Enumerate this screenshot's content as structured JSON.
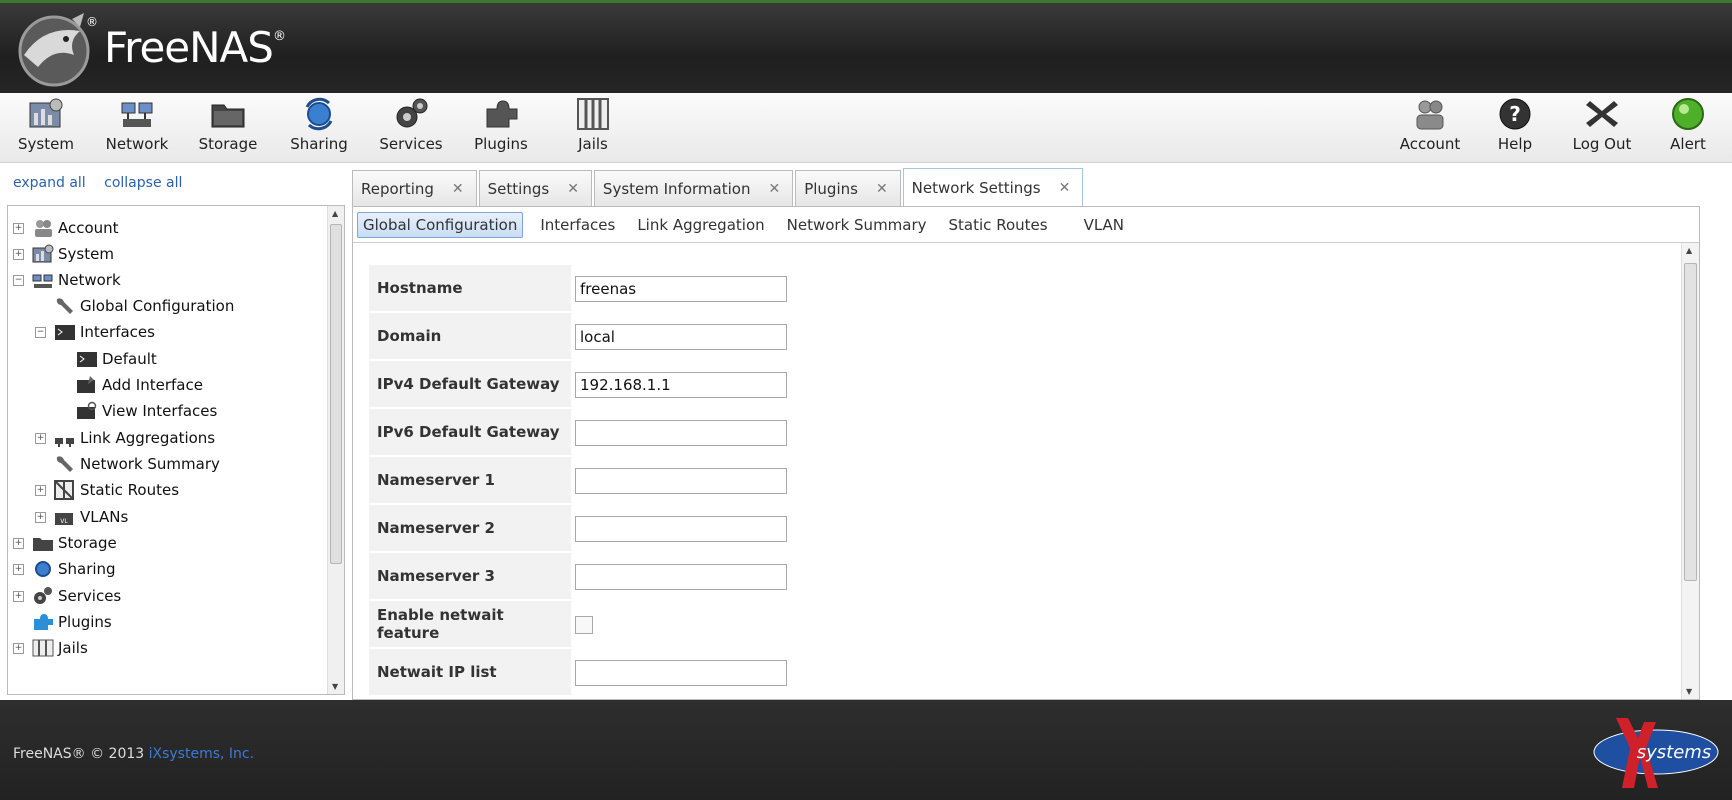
{
  "brand": {
    "name": "FreeNAS",
    "reg": "®",
    "reg_small": "®"
  },
  "toolbar": {
    "left": [
      {
        "label": "System",
        "icon": "system-icon"
      },
      {
        "label": "Network",
        "icon": "network-icon"
      },
      {
        "label": "Storage",
        "icon": "storage-icon"
      },
      {
        "label": "Sharing",
        "icon": "sharing-icon"
      },
      {
        "label": "Services",
        "icon": "services-icon"
      },
      {
        "label": "Plugins",
        "icon": "plugins-icon"
      },
      {
        "label": "Jails",
        "icon": "jails-icon"
      }
    ],
    "right": [
      {
        "label": "Account",
        "icon": "account-icon"
      },
      {
        "label": "Help",
        "icon": "help-icon"
      },
      {
        "label": "Log Out",
        "icon": "logout-icon"
      },
      {
        "label": "Alert",
        "icon": "alert-icon"
      }
    ]
  },
  "sidebar": {
    "expand_all": "expand all",
    "collapse_all": "collapse all",
    "items": [
      {
        "label": "Account",
        "toggle": "+"
      },
      {
        "label": "System",
        "toggle": "+"
      },
      {
        "label": "Network",
        "toggle": "−"
      },
      {
        "label": "Global Configuration"
      },
      {
        "label": "Interfaces",
        "toggle": "−"
      },
      {
        "label": "Default"
      },
      {
        "label": "Add Interface"
      },
      {
        "label": "View Interfaces"
      },
      {
        "label": "Link Aggregations",
        "toggle": "+"
      },
      {
        "label": "Network Summary"
      },
      {
        "label": "Static Routes",
        "toggle": "+"
      },
      {
        "label": "VLANs",
        "toggle": "+"
      },
      {
        "label": "Storage",
        "toggle": "+"
      },
      {
        "label": "Sharing",
        "toggle": "+"
      },
      {
        "label": "Services",
        "toggle": "+"
      },
      {
        "label": "Plugins"
      },
      {
        "label": "Jails",
        "toggle": "+"
      }
    ]
  },
  "tabs": [
    {
      "label": "Reporting"
    },
    {
      "label": "Settings"
    },
    {
      "label": "System Information"
    },
    {
      "label": "Plugins"
    },
    {
      "label": "Network Settings",
      "active": true
    }
  ],
  "subtabs": [
    {
      "label": "Global Configuration",
      "active": true
    },
    {
      "label": "Interfaces"
    },
    {
      "label": "Link Aggregation"
    },
    {
      "label": "Network Summary"
    },
    {
      "label": "Static Routes"
    },
    {
      "label": "VLAN"
    }
  ],
  "form": {
    "fields": [
      {
        "label": "Hostname",
        "value": "freenas"
      },
      {
        "label": "Domain",
        "value": "local"
      },
      {
        "label": "IPv4 Default Gateway",
        "value": "192.168.1.1"
      },
      {
        "label": "IPv6 Default Gateway",
        "value": ""
      },
      {
        "label": "Nameserver 1",
        "value": ""
      },
      {
        "label": "Nameserver 2",
        "value": ""
      },
      {
        "label": "Nameserver 3",
        "value": ""
      },
      {
        "label": "Enable netwait feature",
        "type": "checkbox",
        "checked": false
      },
      {
        "label": "Netwait IP list",
        "value": ""
      }
    ]
  },
  "footer": {
    "copyright": "FreeNAS® © 2013 ",
    "company": "iXsystems, Inc.",
    "partner_logo": "systems"
  },
  "colors": {
    "accent": "#2a62b0",
    "header": "#262626",
    "topline": "#3b7a2a"
  }
}
